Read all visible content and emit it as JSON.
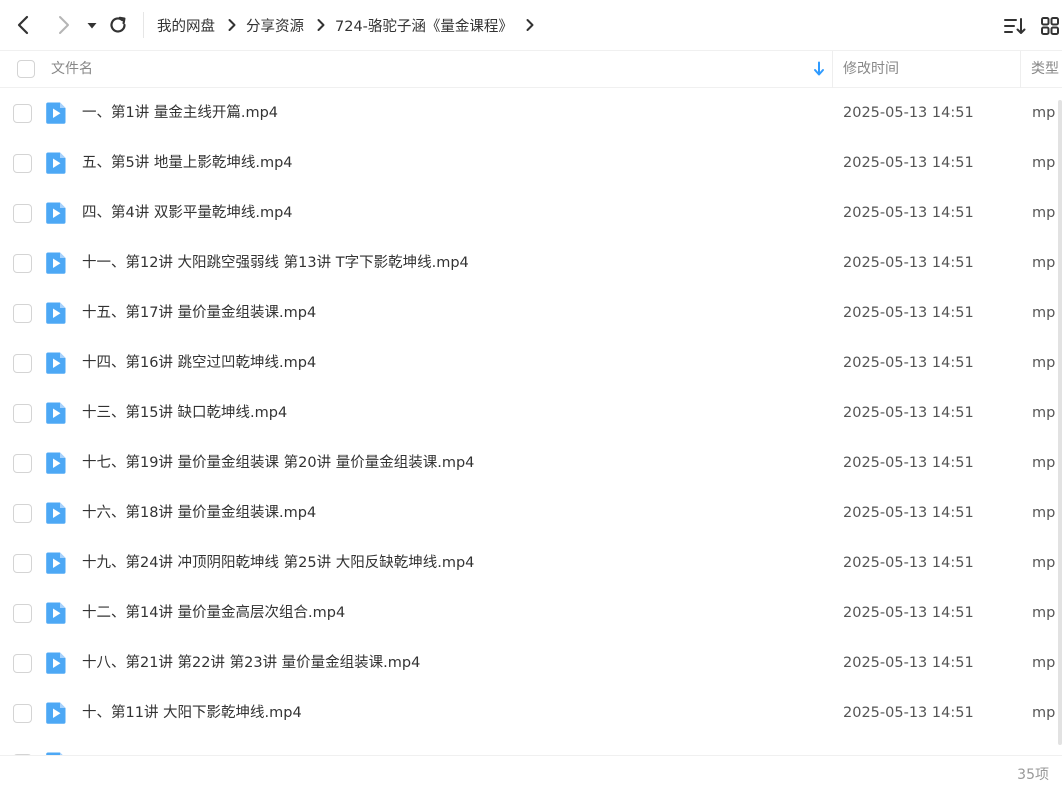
{
  "toolbar": {
    "breadcrumb": [
      "我的网盘",
      "分享资源",
      "724-骆驼子涵《量金课程》"
    ]
  },
  "header": {
    "name_label": "文件名",
    "time_label": "修改时间",
    "type_label": "类型"
  },
  "files": [
    {
      "name": "一、第1讲 量金主线开篇.mp4",
      "time": "2025-05-13 14:51",
      "type": "mp"
    },
    {
      "name": "五、第5讲 地量上影乾坤线.mp4",
      "time": "2025-05-13 14:51",
      "type": "mp"
    },
    {
      "name": "四、第4讲 双影平量乾坤线.mp4",
      "time": "2025-05-13 14:51",
      "type": "mp"
    },
    {
      "name": "十一、第12讲 大阳跳空强弱线  第13讲 T字下影乾坤线.mp4",
      "time": "2025-05-13 14:51",
      "type": "mp"
    },
    {
      "name": "十五、第17讲 量价量金组装课.mp4",
      "time": "2025-05-13 14:51",
      "type": "mp"
    },
    {
      "name": "十四、第16讲 跳空过凹乾坤线.mp4",
      "time": "2025-05-13 14:51",
      "type": "mp"
    },
    {
      "name": "十三、第15讲 缺口乾坤线.mp4",
      "time": "2025-05-13 14:51",
      "type": "mp"
    },
    {
      "name": "十七、第19讲 量价量金组装课  第20讲 量价量金组装课.mp4",
      "time": "2025-05-13 14:51",
      "type": "mp"
    },
    {
      "name": "十六、第18讲 量价量金组装课.mp4",
      "time": "2025-05-13 14:51",
      "type": "mp"
    },
    {
      "name": "十九、第24讲 冲顶阴阳乾坤线  第25讲 大阳反缺乾坤线.mp4",
      "time": "2025-05-13 14:51",
      "type": "mp"
    },
    {
      "name": "十二、第14讲 量价量金高层次组合.mp4",
      "time": "2025-05-13 14:51",
      "type": "mp"
    },
    {
      "name": "十八、第21讲 第22讲 第23讲 量价量金组装课.mp4",
      "time": "2025-05-13 14:51",
      "type": "mp"
    },
    {
      "name": "十、第11讲 大阳下影乾坤线.mp4",
      "time": "2025-05-13 14:51",
      "type": "mp"
    },
    {
      "name": "",
      "time": "",
      "type": ""
    }
  ],
  "footer": {
    "count": "35项"
  },
  "colors": {
    "accent": "#2f9bff",
    "file_icon": "#4da8f5"
  },
  "icons": {
    "back": "chevron-left-icon",
    "forward": "chevron-right-icon",
    "dropdown": "caret-down-icon",
    "refresh": "refresh-icon",
    "sort": "sort-list-icon",
    "view": "grid-view-icon",
    "file": "video-file-icon"
  }
}
